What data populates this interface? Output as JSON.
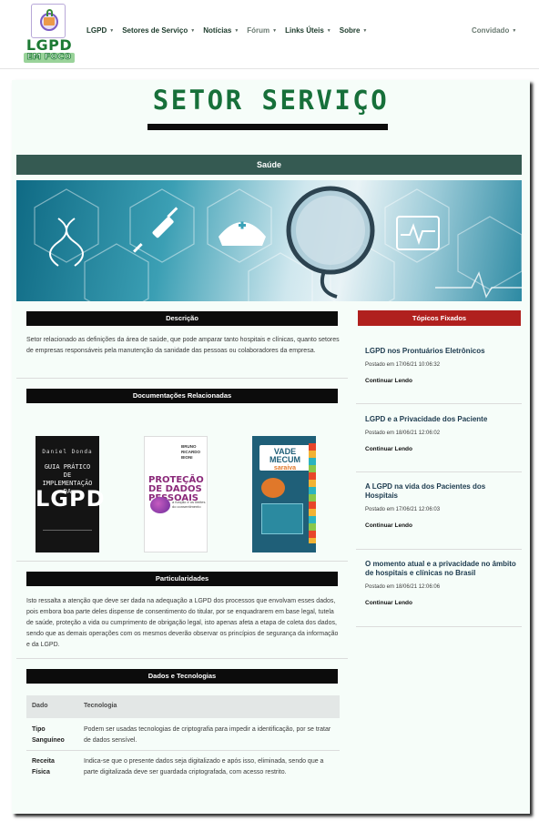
{
  "brand": {
    "title": "LGPD",
    "subtitle": "EM FOCO"
  },
  "nav": {
    "items": [
      {
        "label": "LGPD"
      },
      {
        "label": "Setores de Serviço"
      },
      {
        "label": "Notícias"
      },
      {
        "label": "Fórum"
      },
      {
        "label": "Links Úteis"
      },
      {
        "label": "Sobre"
      }
    ],
    "user": "Convidado"
  },
  "page": {
    "title": "SETOR SERVIÇO",
    "sector": "Saúde"
  },
  "banner": {
    "icons": [
      "dna-icon",
      "syringe-icon",
      "nurse-cap-icon",
      "stethoscope-icon",
      "heart-monitor-icon"
    ]
  },
  "description": {
    "heading": "Descrição",
    "text": "Setor relacionado as definições da área de saúde, que pode amparar tanto hospitais e clínicas, quanto setores de empresas responsáveis pela manutenção da sanidade das pessoas ou colaboradores da empresa."
  },
  "docs": {
    "heading": "Documentações Relacionadas",
    "books": [
      {
        "author": "Daniel Donda",
        "title": "GUIA PRÁTICO DE IMPLEMENTAÇÃO DA",
        "big": "LGPD"
      },
      {
        "author": "BRUNO RICARDO BIONI",
        "title": "PROTEÇÃO DE DADOS PESSOAIS",
        "sub": "a função e os limites do consentimento"
      },
      {
        "title": "VADE MECUM",
        "sub": "saraiva"
      }
    ]
  },
  "particularities": {
    "heading": "Particularidades",
    "text": "Isto ressalta a atenção que deve ser dada na adequação a LGPD dos processos que envolvam esses dados, pois embora boa parte deles dispense de consentimento do titular, por se enquadrarem em base legal, tutela de saúde, proteção a vida ou cumprimento de obrigação legal, isto apenas afeta a etapa de coleta dos dados, sendo que as demais operações com os mesmos deverão observar os princípios de segurança da informação e da LGPD."
  },
  "tech": {
    "heading": "Dados e Tecnologias",
    "col_data": "Dado",
    "col_tech": "Tecnologia",
    "rows": [
      {
        "data": "Tipo Sanguíneo",
        "tech": "Podem ser usadas tecnologias de criptografia para impedir a identificação, por se tratar de dados sensível."
      },
      {
        "data": "Receita Física",
        "tech": "Indica-se que o presente dados seja digitalizado e após isso, eliminada, sendo que a parte digitalizada deve ser guardada criptografada, com acesso restrito."
      }
    ]
  },
  "topics": {
    "heading": "Tópicos Fixados",
    "link_label": "Continuar Lendo",
    "items": [
      {
        "title": "LGPD nos Prontuários Eletrônicos",
        "date": "Postado em 17/06/21 10:06:32"
      },
      {
        "title": "LGPD e a Privacidade dos Paciente",
        "date": "Postado em 18/06/21 12:06:02"
      },
      {
        "title": "A LGPD na vida dos Pacientes dos Hospitais",
        "date": "Postado em 17/06/21 12:06:03"
      },
      {
        "title": "O momento atual e a privacidade no âmbito de hospitais e clínicas no Brasil",
        "date": "Postado em 18/06/21 12:06:06"
      }
    ]
  }
}
